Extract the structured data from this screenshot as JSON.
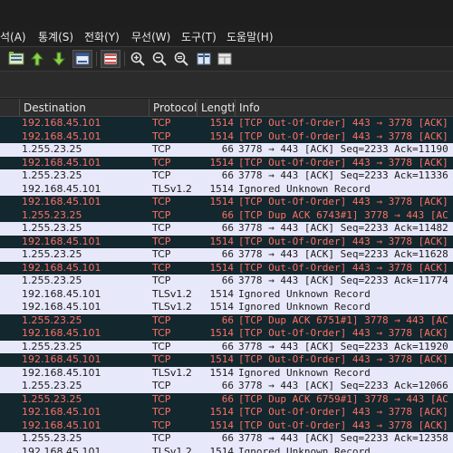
{
  "menu": {
    "items": [
      "석(A)",
      "통계(S)",
      "전화(Y)",
      "무선(W)",
      "도구(T)",
      "도움말(H)"
    ]
  },
  "toolbar": {
    "buttons": [
      "packet-list-icon",
      "go-up-icon",
      "go-down-icon",
      "autoscroll-icon",
      "colorize-icon",
      "zoom-in-icon",
      "zoom-out-icon",
      "zoom-reset-icon",
      "resize-columns-icon",
      "layout-icon"
    ]
  },
  "columns": {
    "destination": "Destination",
    "protocol": "Protocol",
    "length": "Length",
    "info": "Info"
  },
  "colors": {
    "error_row_bg": "#12272e",
    "error_row_fg": "#ff6f63",
    "normal_row_bg": "#e8e8fb"
  },
  "packets": [
    {
      "dst": "192.168.45.101",
      "proto": "TCP",
      "len": "1514",
      "info": "[TCP Out-Of-Order] 443 → 3778 [ACK]",
      "type": "oo"
    },
    {
      "dst": "192.168.45.101",
      "proto": "TCP",
      "len": "1514",
      "info": "[TCP Out-Of-Order] 443 → 3778 [ACK]",
      "type": "oo"
    },
    {
      "dst": "1.255.23.25",
      "proto": "TCP",
      "len": "66",
      "info": "3778 → 443 [ACK] Seq=2233 Ack=11190",
      "type": "ok"
    },
    {
      "dst": "192.168.45.101",
      "proto": "TCP",
      "len": "1514",
      "info": "[TCP Out-Of-Order] 443 → 3778 [ACK]",
      "type": "oo"
    },
    {
      "dst": "1.255.23.25",
      "proto": "TCP",
      "len": "66",
      "info": "3778 → 443 [ACK] Seq=2233 Ack=11336",
      "type": "ok"
    },
    {
      "dst": "192.168.45.101",
      "proto": "TLSv1.2",
      "len": "1514",
      "info": "Ignored Unknown Record",
      "type": "ok"
    },
    {
      "dst": "192.168.45.101",
      "proto": "TCP",
      "len": "1514",
      "info": "[TCP Out-Of-Order] 443 → 3778 [ACK]",
      "type": "oo"
    },
    {
      "dst": "1.255.23.25",
      "proto": "TCP",
      "len": "66",
      "info": "[TCP Dup ACK 6743#1] 3778 → 443 [AC",
      "type": "oo"
    },
    {
      "dst": "1.255.23.25",
      "proto": "TCP",
      "len": "66",
      "info": "3778 → 443 [ACK] Seq=2233 Ack=11482",
      "type": "ok"
    },
    {
      "dst": "192.168.45.101",
      "proto": "TCP",
      "len": "1514",
      "info": "[TCP Out-Of-Order] 443 → 3778 [ACK]",
      "type": "oo"
    },
    {
      "dst": "1.255.23.25",
      "proto": "TCP",
      "len": "66",
      "info": "3778 → 443 [ACK] Seq=2233 Ack=11628",
      "type": "ok"
    },
    {
      "dst": "192.168.45.101",
      "proto": "TCP",
      "len": "1514",
      "info": "[TCP Out-Of-Order] 443 → 3778 [ACK]",
      "type": "oo"
    },
    {
      "dst": "1.255.23.25",
      "proto": "TCP",
      "len": "66",
      "info": "3778 → 443 [ACK] Seq=2233 Ack=11774",
      "type": "ok"
    },
    {
      "dst": "192.168.45.101",
      "proto": "TLSv1.2",
      "len": "1514",
      "info": "Ignored Unknown Record",
      "type": "ok"
    },
    {
      "dst": "192.168.45.101",
      "proto": "TLSv1.2",
      "len": "1514",
      "info": "Ignored Unknown Record",
      "type": "ok"
    },
    {
      "dst": "1.255.23.25",
      "proto": "TCP",
      "len": "66",
      "info": "[TCP Dup ACK 6751#1] 3778 → 443 [AC",
      "type": "oo"
    },
    {
      "dst": "192.168.45.101",
      "proto": "TCP",
      "len": "1514",
      "info": "[TCP Out-Of-Order] 443 → 3778 [ACK]",
      "type": "oo"
    },
    {
      "dst": "1.255.23.25",
      "proto": "TCP",
      "len": "66",
      "info": "3778 → 443 [ACK] Seq=2233 Ack=11920",
      "type": "ok"
    },
    {
      "dst": "192.168.45.101",
      "proto": "TCP",
      "len": "1514",
      "info": "[TCP Out-Of-Order] 443 → 3778 [ACK]",
      "type": "oo"
    },
    {
      "dst": "192.168.45.101",
      "proto": "TLSv1.2",
      "len": "1514",
      "info": "Ignored Unknown Record",
      "type": "ok"
    },
    {
      "dst": "1.255.23.25",
      "proto": "TCP",
      "len": "66",
      "info": "3778 → 443 [ACK] Seq=2233 Ack=12066",
      "type": "ok"
    },
    {
      "dst": "1.255.23.25",
      "proto": "TCP",
      "len": "66",
      "info": "[TCP Dup ACK 6759#1] 3778 → 443 [AC",
      "type": "oo"
    },
    {
      "dst": "192.168.45.101",
      "proto": "TCP",
      "len": "1514",
      "info": "[TCP Out-Of-Order] 443 → 3778 [ACK]",
      "type": "oo"
    },
    {
      "dst": "192.168.45.101",
      "proto": "TCP",
      "len": "1514",
      "info": "[TCP Out-Of-Order] 443 → 3778 [ACK]",
      "type": "oo"
    },
    {
      "dst": "1.255.23.25",
      "proto": "TCP",
      "len": "66",
      "info": "3778 → 443 [ACK] Seq=2233 Ack=12358",
      "type": "ok"
    },
    {
      "dst": "192.168.45.101",
      "proto": "TLSv1.2",
      "len": "1514",
      "info": "Ignored Unknown Record",
      "type": "ok"
    }
  ]
}
